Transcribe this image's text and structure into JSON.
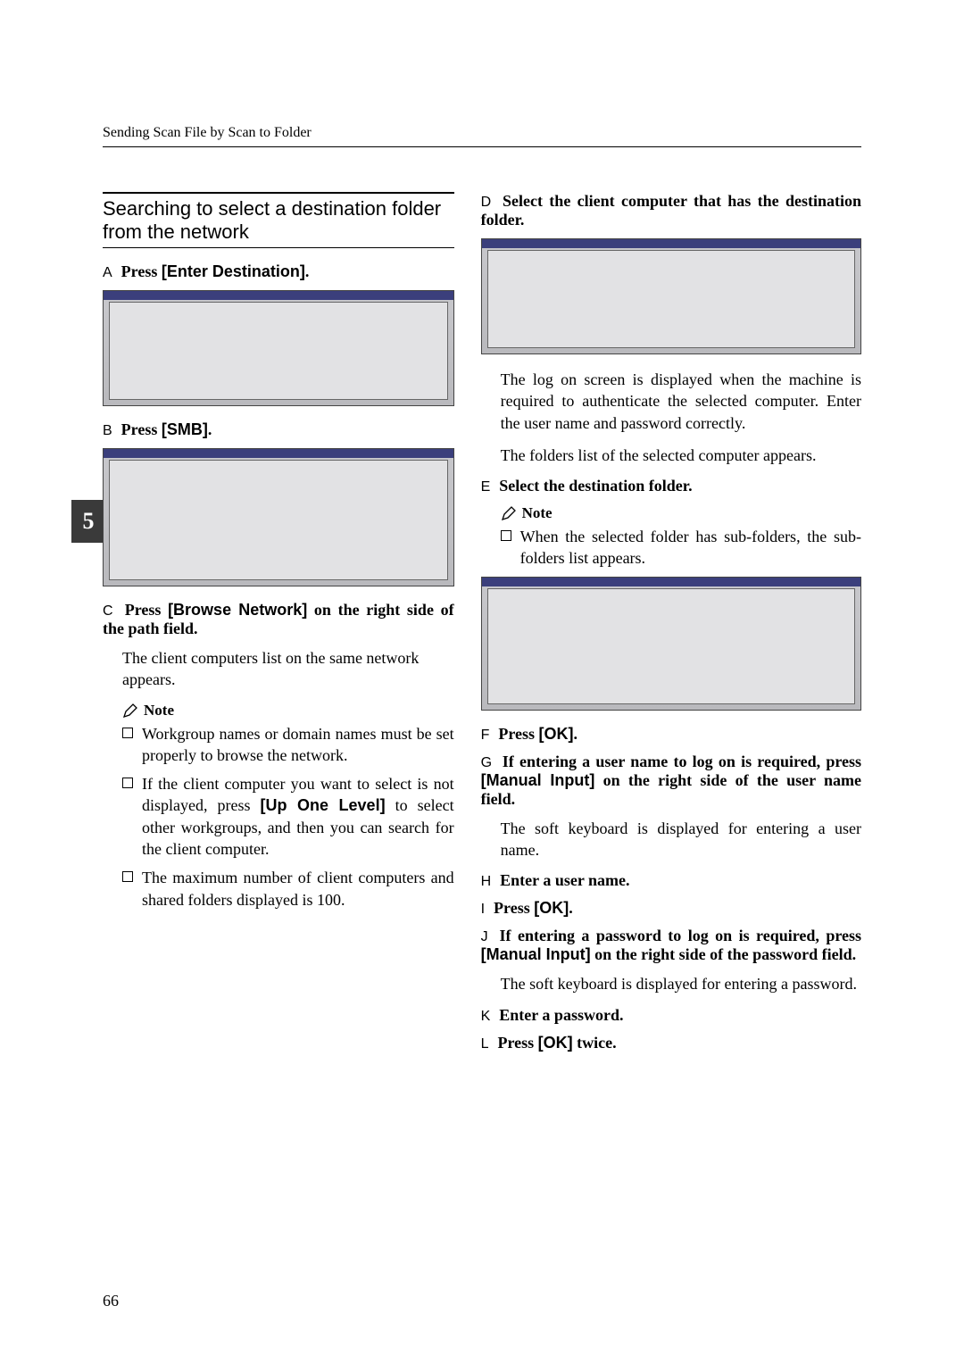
{
  "page": {
    "running_header": "Sending Scan File by Scan to Folder",
    "number": "66",
    "chapter_tab": "5"
  },
  "section": {
    "title": "Searching to select a destination folder from the network"
  },
  "left": {
    "stepA": {
      "letter": "A",
      "pre": "Press ",
      "key": "[Enter Destination]",
      "post": "."
    },
    "stepB": {
      "letter": "B",
      "pre": "Press ",
      "key": "[SMB]",
      "post": "."
    },
    "stepC": {
      "letter": "C",
      "pre": "Press ",
      "key": "[Browse Network]",
      "post": " on the right side of the path field."
    },
    "paraC": "The client computers list on the same network appears.",
    "note_label": "Note",
    "note1": "Workgroup names or domain names must be set properly to browse the network.",
    "note2_pre": "If the client computer you want to select is not displayed, press ",
    "note2_key": "[Up One Level]",
    "note2_post": " to select other workgroups, and then you can search for the client computer.",
    "note3": "The maximum number of client computers and shared folders displayed is 100."
  },
  "right": {
    "stepD": {
      "letter": "D",
      "text": "Select the client computer that has the destination folder."
    },
    "paraD1": "The log on screen is displayed when the machine is required to authenticate the selected computer. Enter the user name and password correctly.",
    "paraD2": "The folders list of the selected computer appears.",
    "stepE": {
      "letter": "E",
      "text": "Select the destination folder."
    },
    "note_label": "Note",
    "noteE": "When the selected folder has sub-folders, the sub-folders list appears.",
    "stepF": {
      "letter": "F",
      "pre": "Press ",
      "key": "[OK]",
      "post": "."
    },
    "stepG": {
      "letter": "G",
      "pre": "If entering a user name to log on is required, press ",
      "key": "[Manual Input]",
      "post": " on the right side of the user name field."
    },
    "paraG": "The soft keyboard is displayed for entering a user name.",
    "stepH": {
      "letter": "H",
      "text": "Enter a user name."
    },
    "stepI": {
      "letter": "I",
      "pre": "Press ",
      "key": "[OK]",
      "post": "."
    },
    "stepJ": {
      "letter": "J",
      "pre": "If entering a password to log on is required, press ",
      "key": "[Manual Input]",
      "post": " on the right side of the password field."
    },
    "paraJ": "The soft keyboard is displayed for entering a password.",
    "stepK": {
      "letter": "K",
      "text": "Enter a password."
    },
    "stepL": {
      "letter": "L",
      "pre": "Press ",
      "key": "[OK]",
      "post": " twice."
    }
  }
}
